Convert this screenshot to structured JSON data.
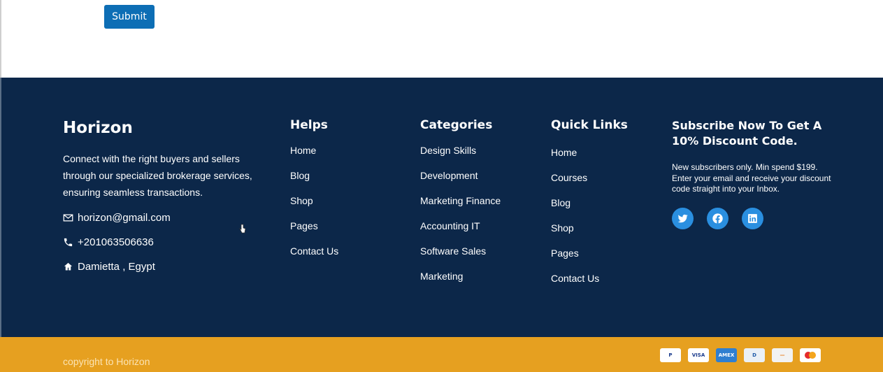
{
  "form": {
    "submit_label": "Submit"
  },
  "footer": {
    "brand": "Horizon",
    "about": "Connect with the right buyers and sellers through our specialized brokerage services, ensuring seamless transactions.",
    "contact": {
      "email": "horizon@gmail.com",
      "phone": "+201063506636",
      "address": "Damietta , Egypt"
    },
    "helps": {
      "title": "Helps",
      "links": [
        "Home",
        "Blog",
        "Shop",
        "Pages",
        "Contact Us"
      ]
    },
    "categories": {
      "title": "Categories",
      "links": [
        "Design Skills",
        "Development",
        "Marketing Finance",
        "Accounting IT",
        "Software Sales",
        "Marketing"
      ]
    },
    "quick_links": {
      "title": "Quick Links",
      "links": [
        "Home",
        "Courses",
        "Blog",
        "Shop",
        "Pages",
        "Contact Us"
      ]
    },
    "subscribe": {
      "title": "Subscribe Now To Get A 10% Discount Code.",
      "text": "New subscribers only. Min spend $199. Enter your email and receive your discount code straight into your Inbox."
    },
    "social_icons": [
      "twitter-icon",
      "facebook-icon",
      "linkedin-icon"
    ]
  },
  "bottom_bar": {
    "copyright": "copyright to Horizon",
    "payment_icons": [
      "paypal-icon",
      "visa-icon",
      "amex-icon",
      "diners-icon",
      "discover-icon",
      "mastercard-icon"
    ],
    "payment_labels": {
      "paypal": "P",
      "visa": "VISA",
      "amex": "AMEX",
      "diners": "D",
      "discover": "—"
    }
  },
  "colors": {
    "footer_bg": "#0c2749",
    "bottom_bar_bg": "#e6a020",
    "accent_button": "#0d6eb5",
    "social_bg": "#2a8fe0"
  }
}
